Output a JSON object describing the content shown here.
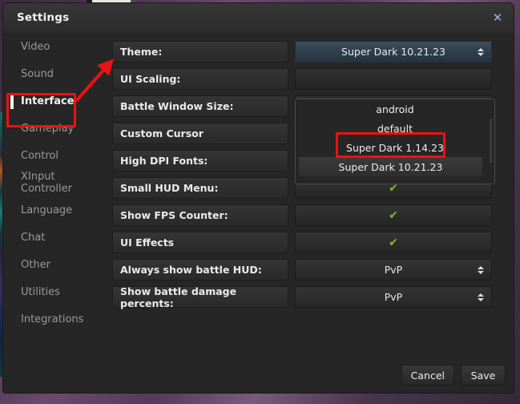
{
  "window": {
    "title": "Settings",
    "close_icon": "close-icon"
  },
  "sidebar": {
    "items": [
      {
        "label": "Video",
        "active": false
      },
      {
        "label": "Sound",
        "active": false
      },
      {
        "label": "Interface",
        "active": true
      },
      {
        "label": "Gameplay",
        "active": false
      },
      {
        "label": "Control",
        "active": false
      },
      {
        "label": "XInput Controller",
        "active": false
      },
      {
        "label": "Language",
        "active": false
      },
      {
        "label": "Chat",
        "active": false
      },
      {
        "label": "Other",
        "active": false
      },
      {
        "label": "Utilities",
        "active": false
      },
      {
        "label": "Integrations",
        "active": false
      }
    ]
  },
  "settings": {
    "rows": [
      {
        "label": "Theme:",
        "control": "select",
        "value": "Super Dark 10.21.23",
        "highlight": true
      },
      {
        "label": "UI Scaling:",
        "control": "empty",
        "value": ""
      },
      {
        "label": "Battle Window Size:",
        "control": "empty",
        "value": ""
      },
      {
        "label": "Custom Cursor",
        "control": "empty",
        "value": ""
      },
      {
        "label": "High DPI Fonts:",
        "control": "check",
        "value": "✔"
      },
      {
        "label": "Small HUD Menu:",
        "control": "check",
        "value": "✔"
      },
      {
        "label": "Show FPS Counter:",
        "control": "check",
        "value": "✔"
      },
      {
        "label": "UI Effects",
        "control": "check",
        "value": "✔"
      },
      {
        "label": "Always show battle HUD:",
        "control": "select",
        "value": "PvP"
      },
      {
        "label": "Show battle damage percents:",
        "control": "select",
        "value": "PvP"
      }
    ]
  },
  "theme_dropdown": {
    "open": true,
    "options": [
      {
        "label": "android",
        "highlighted": false
      },
      {
        "label": "default",
        "highlighted": false
      },
      {
        "label": "Super Dark 1.14.23",
        "highlighted": false
      },
      {
        "label": "Super Dark 10.21.23",
        "highlighted": true
      }
    ]
  },
  "footer": {
    "cancel_label": "Cancel",
    "save_label": "Save"
  },
  "annotations": {
    "highlight_color": "#ee1111",
    "box_interface": "Interface",
    "box_theme_option": "Super Dark 10.21.23",
    "arrow": "points from Interface sidebar item to Theme row"
  },
  "colors": {
    "accent_check": "#7dbb2e",
    "select_blue": "#3f4e5e",
    "window_bg": "#262626",
    "annotation_red": "#ee1111"
  }
}
